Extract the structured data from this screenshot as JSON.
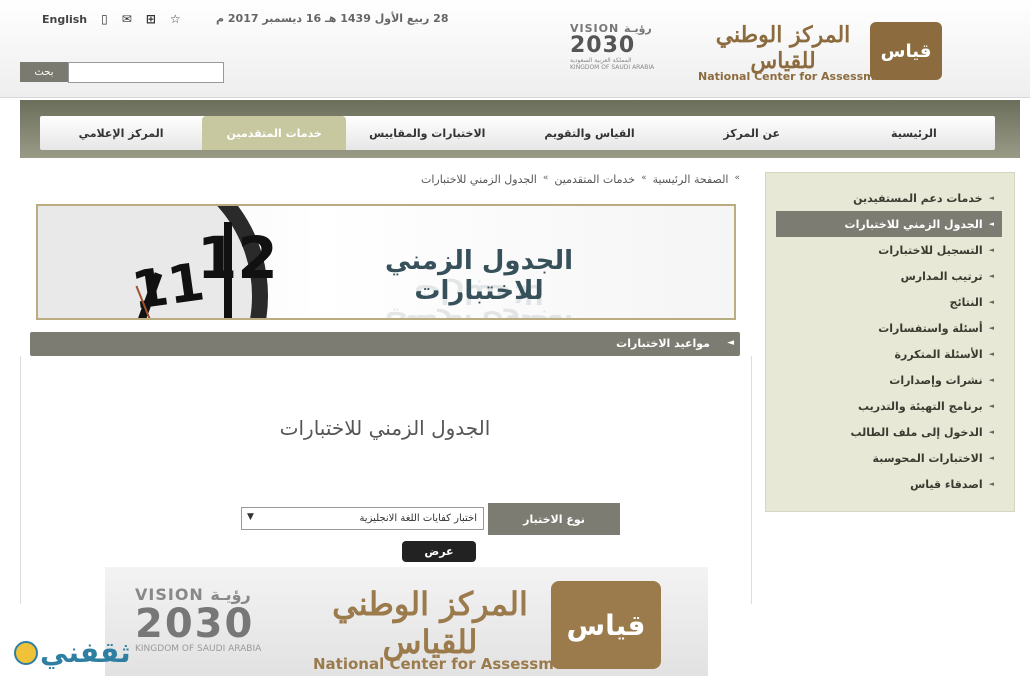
{
  "header": {
    "utility": {
      "language": "English"
    },
    "date": "28 ربيع الأول 1439 هـ 16 ديسمبر 2017 م",
    "search": {
      "button_label": "بحث",
      "placeholder": ""
    },
    "vision_logo": {
      "latin": "VISION",
      "arabic": "رؤيـة",
      "year": "2030",
      "sub_ar": "المملكة العربية السعودية",
      "sub_en": "KINGDOM OF SAUDI ARABIA"
    },
    "org_logo": {
      "arabic": "المركز الوطني للقياس",
      "english": "National Center for Assessment",
      "mark": "قياس"
    }
  },
  "nav": {
    "items": [
      {
        "label": "الرئيسية",
        "active": false
      },
      {
        "label": "عن المركز",
        "active": false
      },
      {
        "label": "القياس والتقويم",
        "active": false
      },
      {
        "label": "الاختبارات والمقاييس",
        "active": false
      },
      {
        "label": "خدمات المتقدمين",
        "active": true
      },
      {
        "label": "المركز الإعلامي",
        "active": false
      }
    ]
  },
  "breadcrumb": [
    "الصفحة الرئيسية",
    "خدمات المتقدمين",
    "الجدول الزمني للاختبارات"
  ],
  "banner": {
    "title": "الجدول الزمني للاختبارات",
    "clock_12": "12",
    "clock_11": "11"
  },
  "section": {
    "title": "مواعيد الاختبارات"
  },
  "content": {
    "heading": "الجدول الزمني للاختبارات",
    "type_label": "نوع الاختبار",
    "select_value": "اختبار كفايات اللغة الانجليزية",
    "submit_label": "عرض"
  },
  "sidebar": {
    "items": [
      {
        "label": "خدمات دعم المستفيدين",
        "active": false
      },
      {
        "label": "الجدول الزمني للاختبارات",
        "active": true
      },
      {
        "label": "التسجيل للاختبارات",
        "active": false
      },
      {
        "label": "ترتيب المدارس",
        "active": false
      },
      {
        "label": "النتائج",
        "active": false
      },
      {
        "label": "أسئلة واستفسارات",
        "active": false
      },
      {
        "label": "الأسئلة المتكررة",
        "active": false
      },
      {
        "label": "نشرات وإصدارات",
        "active": false
      },
      {
        "label": "برنامج التهيئة والتدريب",
        "active": false
      },
      {
        "label": "الدخول إلى ملف الطالب",
        "active": false
      },
      {
        "label": "الاختبارات المحوسبة",
        "active": false
      },
      {
        "label": "اصدقاء قياس",
        "active": false
      }
    ]
  },
  "footer": {
    "vision_latin": "VISION",
    "vision_arabic": "رؤيـة",
    "vision_year": "2030",
    "vision_sub_en": "KINGDOM OF SAUDI ARABIA",
    "org_arabic": "المركز الوطني للقياس",
    "org_english": "National Center for Assessment",
    "mark": "قياس"
  },
  "watermark": {
    "text": "ثقفني"
  }
}
